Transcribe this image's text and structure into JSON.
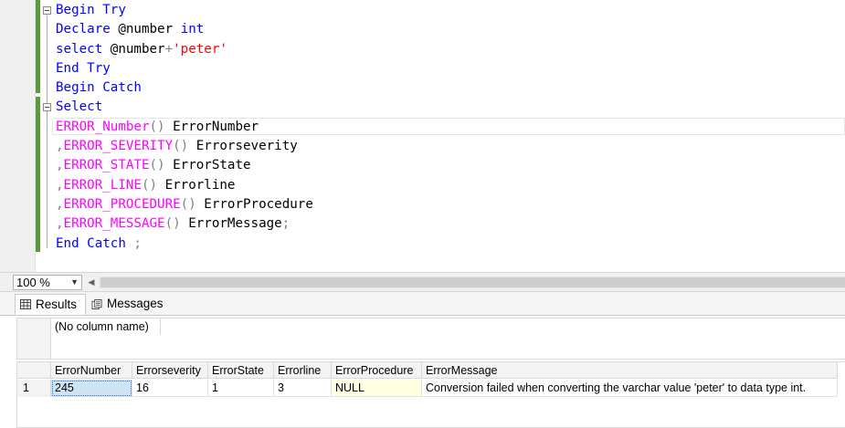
{
  "editor": {
    "lines": [
      [
        {
          "t": "Begin Try",
          "c": "kw"
        }
      ],
      [
        {
          "t": "Declare ",
          "c": "kw"
        },
        {
          "t": "@number ",
          "c": "id"
        },
        {
          "t": "int",
          "c": "kw"
        }
      ],
      [
        {
          "t": "select ",
          "c": "kw"
        },
        {
          "t": "@number",
          "c": "id"
        },
        {
          "t": "+",
          "c": "op"
        },
        {
          "t": "'peter'",
          "c": "str"
        }
      ],
      [
        {
          "t": "End Try",
          "c": "kw"
        }
      ],
      [
        {
          "t": "Begin Catch",
          "c": "kw"
        }
      ],
      [
        {
          "t": "Select",
          "c": "kw"
        }
      ],
      [
        {
          "t": "ERROR_Number",
          "c": "fn"
        },
        {
          "t": "() ",
          "c": "op"
        },
        {
          "t": "ErrorNumber",
          "c": "id"
        }
      ],
      [
        {
          "t": ",",
          "c": "op"
        },
        {
          "t": "ERROR_SEVERITY",
          "c": "fn"
        },
        {
          "t": "() ",
          "c": "op"
        },
        {
          "t": "Errorseverity",
          "c": "id"
        }
      ],
      [
        {
          "t": ",",
          "c": "op"
        },
        {
          "t": "ERROR_STATE",
          "c": "fn"
        },
        {
          "t": "() ",
          "c": "op"
        },
        {
          "t": "ErrorState",
          "c": "id"
        }
      ],
      [
        {
          "t": ",",
          "c": "op"
        },
        {
          "t": "ERROR_LINE",
          "c": "fn"
        },
        {
          "t": "() ",
          "c": "op"
        },
        {
          "t": "Errorline",
          "c": "id"
        }
      ],
      [
        {
          "t": ",",
          "c": "op"
        },
        {
          "t": "ERROR_PROCEDURE",
          "c": "fn"
        },
        {
          "t": "() ",
          "c": "op"
        },
        {
          "t": "ErrorProcedure",
          "c": "id"
        }
      ],
      [
        {
          "t": ",",
          "c": "op"
        },
        {
          "t": "ERROR_MESSAGE",
          "c": "fn"
        },
        {
          "t": "() ",
          "c": "op"
        },
        {
          "t": "ErrorMessage",
          "c": "id"
        },
        {
          "t": ";",
          "c": "op"
        }
      ],
      [
        {
          "t": "End Catch ",
          "c": "kw"
        },
        {
          "t": ";",
          "c": "op"
        }
      ]
    ]
  },
  "zoom": {
    "value": "100 %"
  },
  "tabs": {
    "results_label": "Results",
    "messages_label": "Messages"
  },
  "grid1": {
    "header": "(No column name)"
  },
  "grid2": {
    "columns": [
      "ErrorNumber",
      "Errorseverity",
      "ErrorState",
      "Errorline",
      "ErrorProcedure",
      "ErrorMessage"
    ],
    "rows": [
      {
        "num": "1",
        "cells": [
          "245",
          "16",
          "1",
          "3",
          "NULL",
          "Conversion failed when converting the varchar value 'peter' to data type int."
        ]
      }
    ]
  },
  "colors": {
    "keyword": "#0000ff",
    "function": "#ff00ff",
    "string": "#ff0000",
    "operator": "#808080",
    "change_bar": "#5b9a3c",
    "selected_cell": "#cfe3f7",
    "null_cell": "#ffffe1"
  },
  "icons": {
    "results_tab": "grid-icon",
    "messages_tab": "messages-icon"
  }
}
